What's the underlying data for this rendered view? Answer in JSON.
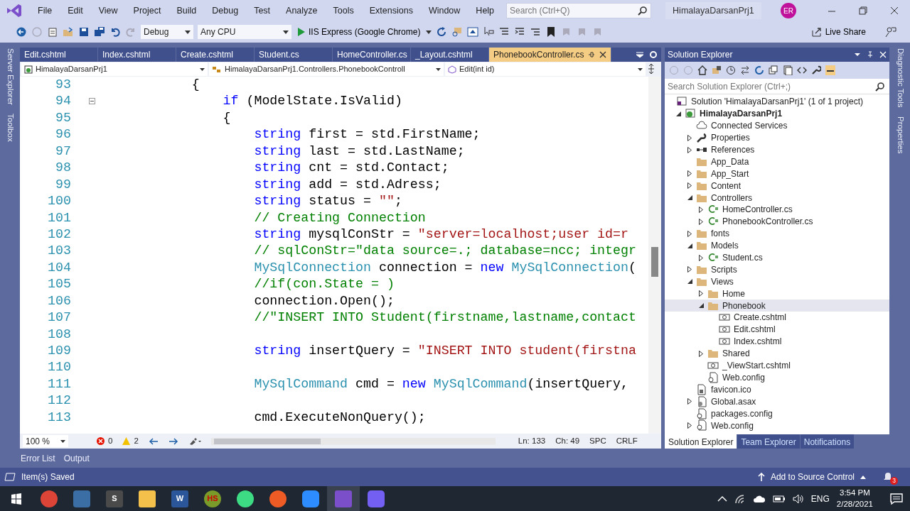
{
  "title_bar": {
    "menus": [
      "File",
      "Edit",
      "View",
      "Project",
      "Build",
      "Debug",
      "Test",
      "Analyze",
      "Tools",
      "Extensions",
      "Window",
      "Help"
    ],
    "search": {
      "placeholder": "Search (Ctrl+Q)"
    },
    "title": "HimalayaDarsanPrj1",
    "avatar": "ER"
  },
  "toolbar": {
    "configuration": "Debug",
    "platform": "Any CPU",
    "run_target": "IIS Express (Google Chrome)",
    "live_share": "Live Share"
  },
  "side_tabs_left": [
    "Server Explorer",
    "Toolbox"
  ],
  "side_tabs_right": [
    "Diagnostic Tools",
    "Properties"
  ],
  "editor": {
    "tabs": [
      {
        "label": "Edit.cshtml",
        "selected": false
      },
      {
        "label": "Index.cshtml",
        "selected": false
      },
      {
        "label": "Create.cshtml",
        "selected": false
      },
      {
        "label": "Student.cs",
        "selected": false
      },
      {
        "label": "HomeController.cs",
        "selected": false
      },
      {
        "label": "_Layout.cshtml",
        "selected": false
      },
      {
        "label": "PhonebookController.cs",
        "selected": true
      }
    ],
    "nav": {
      "project": "HimalayaDarsanPrj1",
      "class": "HimalayaDarsanPrj1.Controllers.PhonebookControll",
      "member": "Edit(int id)"
    },
    "lines": [
      {
        "number": "93",
        "tokens": [
          {
            "t": "            {",
            "kind": "plain"
          }
        ]
      },
      {
        "number": "94",
        "tokens": [
          {
            "t": "                if",
            "kind": "kw"
          },
          {
            "t": " (ModelState.IsValid)",
            "kind": "plain"
          }
        ],
        "foldable": true
      },
      {
        "number": "95",
        "tokens": [
          {
            "t": "                {",
            "kind": "plain"
          }
        ]
      },
      {
        "number": "96",
        "tokens": [
          {
            "t": "                    string",
            "kind": "kw"
          },
          {
            "t": " first = std.FirstName;",
            "kind": "plain"
          }
        ]
      },
      {
        "number": "97",
        "tokens": [
          {
            "t": "                    string",
            "kind": "kw"
          },
          {
            "t": " last = std.LastName;",
            "kind": "plain"
          }
        ]
      },
      {
        "number": "98",
        "tokens": [
          {
            "t": "                    string",
            "kind": "kw"
          },
          {
            "t": " cnt = std.Contact;",
            "kind": "plain"
          }
        ]
      },
      {
        "number": "99",
        "tokens": [
          {
            "t": "                    string",
            "kind": "kw"
          },
          {
            "t": " add = std.Adress;",
            "kind": "plain"
          }
        ]
      },
      {
        "number": "100",
        "tokens": [
          {
            "t": "                    string",
            "kind": "kw"
          },
          {
            "t": " status = ",
            "kind": "plain"
          },
          {
            "t": "\"\"",
            "kind": "str"
          },
          {
            "t": ";",
            "kind": "plain"
          }
        ]
      },
      {
        "number": "101",
        "tokens": [
          {
            "t": "                    // Creating Connection",
            "kind": "cmt"
          }
        ]
      },
      {
        "number": "102",
        "tokens": [
          {
            "t": "                    string",
            "kind": "kw"
          },
          {
            "t": " mysqlConStr = ",
            "kind": "plain"
          },
          {
            "t": "\"server=localhost;user id=r",
            "kind": "str"
          }
        ]
      },
      {
        "number": "103",
        "tokens": [
          {
            "t": "                    // sqlConStr=\"data source=.; database=ncc; integr",
            "kind": "cmt"
          }
        ]
      },
      {
        "number": "104",
        "tokens": [
          {
            "t": "                    MySqlConnection",
            "kind": "type"
          },
          {
            "t": " connection = ",
            "kind": "plain"
          },
          {
            "t": "new",
            "kind": "kw"
          },
          {
            "t": " MySqlConnection",
            "kind": "type"
          },
          {
            "t": "(",
            "kind": "plain"
          }
        ]
      },
      {
        "number": "105",
        "tokens": [
          {
            "t": "                    //if(con.State = )",
            "kind": "cmt"
          }
        ]
      },
      {
        "number": "106",
        "tokens": [
          {
            "t": "                    connection.Open();",
            "kind": "plain"
          }
        ]
      },
      {
        "number": "107",
        "tokens": [
          {
            "t": "                    //\"INSERT INTO Student(firstname,lastname,contact",
            "kind": "cmt"
          }
        ]
      },
      {
        "number": "108"
      },
      {
        "number": "109",
        "tokens": [
          {
            "t": "                    string",
            "kind": "kw"
          },
          {
            "t": " insertQuery = ",
            "kind": "plain"
          },
          {
            "t": "\"INSERT INTO student(firstna",
            "kind": "str"
          }
        ]
      },
      {
        "number": "110"
      },
      {
        "number": "111",
        "tokens": [
          {
            "t": "                    MySqlCommand",
            "kind": "type"
          },
          {
            "t": " cmd = ",
            "kind": "plain"
          },
          {
            "t": "new",
            "kind": "kw"
          },
          {
            "t": " MySqlCommand",
            "kind": "type"
          },
          {
            "t": "(insertQuery,",
            "kind": "plain"
          }
        ]
      },
      {
        "number": "112"
      },
      {
        "number": "113",
        "tokens": [
          {
            "t": "                    cmd.ExecuteNonQuery();",
            "kind": "plain"
          }
        ]
      }
    ],
    "status": {
      "zoom": "100 %",
      "errors": "0",
      "warnings": "2",
      "line": "Ln: 133",
      "column": "Ch: 49",
      "indent": "SPC",
      "line_ending": "CRLF"
    }
  },
  "solution_explorer": {
    "title": "Solution Explorer",
    "search": {
      "placeholder": "Search Solution Explorer (Ctrl+;)"
    },
    "tree": [
      {
        "label": "Solution 'HimalayaDarsanPrj1' (1 of 1 project)",
        "kind": "solution",
        "selected": false,
        "children": [
          {
            "label": "HimalayaDarsanPrj1",
            "kind": "project",
            "selected": false,
            "expanded": true,
            "children": [
              {
                "label": "Connected Services",
                "kind": "cloud",
                "selected": false
              },
              {
                "label": "Properties",
                "kind": "wrench",
                "selected": false,
                "expanded": false
              },
              {
                "label": "References",
                "kind": "references",
                "selected": false,
                "expanded": false
              },
              {
                "label": "App_Data",
                "kind": "folder",
                "selected": false
              },
              {
                "label": "App_Start",
                "kind": "folder",
                "selected": false,
                "expanded": false
              },
              {
                "label": "Content",
                "kind": "folder",
                "selected": false,
                "expanded": false
              },
              {
                "label": "Controllers",
                "kind": "folder",
                "selected": false,
                "expanded": true,
                "children": [
                  {
                    "label": "HomeController.cs",
                    "kind": "csharp",
                    "selected": false,
                    "expanded": false
                  },
                  {
                    "label": "PhonebookController.cs",
                    "kind": "csharp",
                    "selected": false,
                    "expanded": false
                  }
                ]
              },
              {
                "label": "fonts",
                "kind": "folder",
                "selected": false,
                "expanded": false
              },
              {
                "label": "Models",
                "kind": "folder",
                "selected": false,
                "expanded": true,
                "children": [
                  {
                    "label": "Student.cs",
                    "kind": "csharp",
                    "selected": false,
                    "expanded": false
                  }
                ]
              },
              {
                "label": "Scripts",
                "kind": "folder",
                "selected": false,
                "expanded": false
              },
              {
                "label": "Views",
                "kind": "folder",
                "selected": false,
                "expanded": true,
                "children": [
                  {
                    "label": "Home",
                    "kind": "folder",
                    "selected": false,
                    "expanded": false
                  },
                  {
                    "label": "Phonebook",
                    "kind": "folder",
                    "selected": true,
                    "expanded": true,
                    "children": [
                      {
                        "label": "Create.cshtml",
                        "kind": "razor",
                        "selected": false
                      },
                      {
                        "label": "Edit.cshtml",
                        "kind": "razor",
                        "selected": false
                      },
                      {
                        "label": "Index.cshtml",
                        "kind": "razor",
                        "selected": false
                      }
                    ]
                  },
                  {
                    "label": "Shared",
                    "kind": "folder",
                    "selected": false,
                    "expanded": false
                  },
                  {
                    "label": "_ViewStart.cshtml",
                    "kind": "razor",
                    "selected": false
                  },
                  {
                    "label": "Web.config",
                    "kind": "config",
                    "selected": false
                  }
                ]
              },
              {
                "label": "favicon.ico",
                "kind": "file",
                "selected": false
              },
              {
                "label": "Global.asax",
                "kind": "asax",
                "selected": false,
                "expanded": false
              },
              {
                "label": "packages.config",
                "kind": "config",
                "selected": false
              },
              {
                "label": "Web.config",
                "kind": "config",
                "selected": false,
                "expanded": false
              }
            ]
          }
        ]
      }
    ],
    "bottom_tabs": [
      {
        "label": "Solution Explorer",
        "selected": true
      },
      {
        "label": "Team Explorer",
        "selected": false
      },
      {
        "label": "Notifications",
        "selected": false
      }
    ]
  },
  "bottom_panel_tabs": [
    "Error List",
    "Output"
  ],
  "status_bar": {
    "message": "Item(s) Saved",
    "source_control": "Add to Source Control",
    "notifications": "3"
  },
  "taskbar": {
    "apps": [
      {
        "kind": "chrome",
        "selected": false
      },
      {
        "kind": "lock",
        "selected": false
      },
      {
        "kind": "sublime",
        "text": "S",
        "selected": false
      },
      {
        "kind": "explorer",
        "selected": false
      },
      {
        "kind": "word",
        "text": "W",
        "selected": false
      },
      {
        "kind": "hs",
        "text": "HS",
        "selected": false
      },
      {
        "kind": "android",
        "selected": false
      },
      {
        "kind": "postman",
        "selected": false
      },
      {
        "kind": "zoom",
        "selected": false
      },
      {
        "kind": "vs",
        "selected": true
      },
      {
        "kind": "viber",
        "selected": false
      }
    ],
    "language": "ENG",
    "time": "3:54 PM",
    "date": "2/28/2021"
  }
}
